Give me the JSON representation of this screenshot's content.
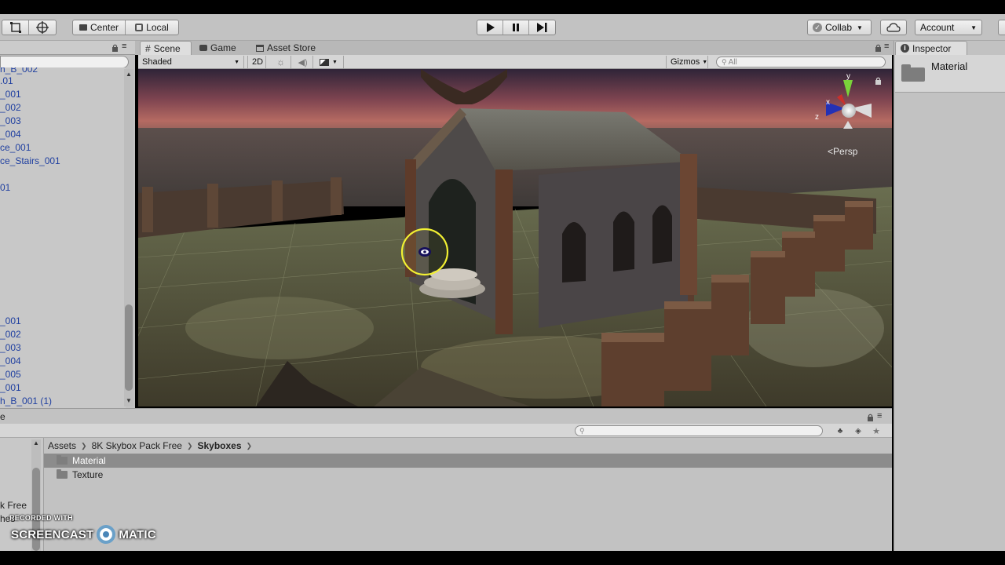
{
  "toolbar": {
    "pivot_label": "Center",
    "space_label": "Local",
    "collab_label": "Collab",
    "account_label": "Account",
    "colors": {
      "bg": "#c2c2c2",
      "button": "#e6e6e6"
    }
  },
  "hierarchy": {
    "items": [
      "h_B_002",
      ".01",
      "_001",
      "_002",
      "_003",
      "_004",
      "ce_001",
      "ce_Stairs_001",
      "",
      "01",
      "_001",
      "_002",
      "_003",
      "_004",
      "_005",
      "_001",
      "h_B_001 (1)"
    ]
  },
  "scene": {
    "tabs": {
      "scene": "Scene",
      "game": "Game",
      "asset_store": "Asset Store"
    },
    "shading_mode": "Shaded",
    "mode_2d": "2D",
    "gizmos_label": "Gizmos",
    "search_placeholder": "All",
    "persp_label": "Persp",
    "gizmo_axes": {
      "x": "x",
      "y": "y",
      "z": "z"
    }
  },
  "inspector": {
    "tab_label": "Inspector",
    "object_name": "Material"
  },
  "project": {
    "header_label": "e",
    "breadcrumb": [
      "Assets",
      "8K Skybox Pack Free",
      "Skyboxes"
    ],
    "items": [
      {
        "name": "Material",
        "selected": true
      },
      {
        "name": "Texture",
        "selected": false
      }
    ],
    "left_tree": [
      "k Free",
      "hes"
    ]
  },
  "watermark": {
    "small": "RECORDED WITH",
    "left": "SCREENCAST",
    "right": "MATIC"
  }
}
